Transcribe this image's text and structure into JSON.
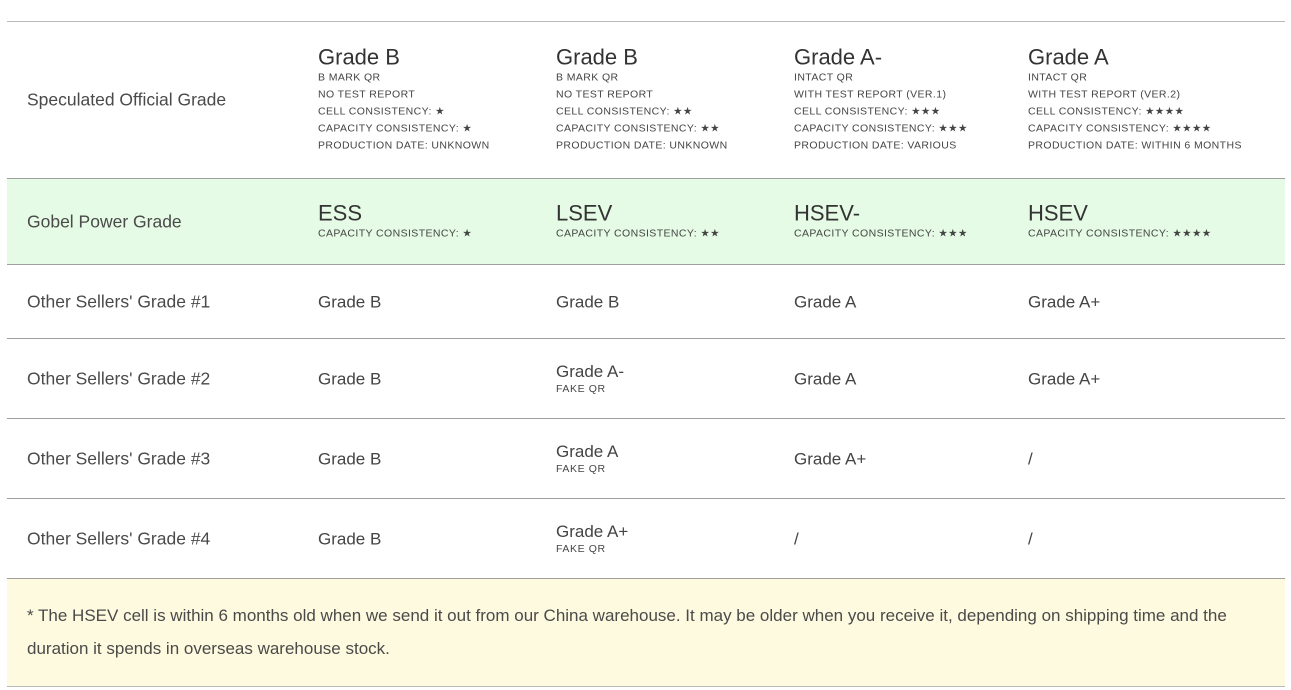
{
  "rows": {
    "official": {
      "label": "Speculated Official Grade",
      "cells": [
        {
          "title": "Grade B",
          "lines": [
            "B MARK QR",
            "NO TEST REPORT",
            "CELL CONSISTENCY: ★",
            "CAPACITY CONSISTENCY: ★",
            "PRODUCTION DATE: UNKNOWN"
          ]
        },
        {
          "title": "Grade B",
          "lines": [
            "B MARK QR",
            "NO TEST REPORT",
            "CELL CONSISTENCY: ★★",
            "CAPACITY CONSISTENCY: ★★",
            "PRODUCTION DATE: UNKNOWN"
          ]
        },
        {
          "title": "Grade A-",
          "lines": [
            "INTACT QR",
            "WITH TEST REPORT (VER.1)",
            "CELL CONSISTENCY: ★★★",
            "CAPACITY CONSISTENCY: ★★★",
            "PRODUCTION DATE: VARIOUS"
          ]
        },
        {
          "title": "Grade A",
          "lines": [
            "INTACT QR",
            "WITH TEST REPORT (VER.2)",
            "CELL CONSISTENCY: ★★★★",
            "CAPACITY CONSISTENCY: ★★★★",
            "PRODUCTION DATE: WITHIN 6 MONTHS"
          ]
        }
      ]
    },
    "gobel": {
      "label": "Gobel Power Grade",
      "cells": [
        {
          "title": "ESS",
          "line": "CAPACITY CONSISTENCY: ★"
        },
        {
          "title": "LSEV",
          "line": "CAPACITY CONSISTENCY: ★★"
        },
        {
          "title": "HSEV-",
          "line": "CAPACITY CONSISTENCY: ★★★"
        },
        {
          "title": "HSEV",
          "line": "CAPACITY CONSISTENCY: ★★★★"
        }
      ]
    },
    "other1": {
      "label": "Other Sellers' Grade #1",
      "cells": [
        {
          "value": "Grade B",
          "tag": ""
        },
        {
          "value": "Grade B",
          "tag": ""
        },
        {
          "value": "Grade A",
          "tag": ""
        },
        {
          "value": "Grade A+",
          "tag": ""
        }
      ]
    },
    "other2": {
      "label": "Other Sellers' Grade #2",
      "cells": [
        {
          "value": "Grade B",
          "tag": ""
        },
        {
          "value": "Grade A-",
          "tag": "FAKE QR"
        },
        {
          "value": "Grade A",
          "tag": ""
        },
        {
          "value": "Grade A+",
          "tag": ""
        }
      ]
    },
    "other3": {
      "label": "Other Sellers' Grade #3",
      "cells": [
        {
          "value": "Grade B",
          "tag": ""
        },
        {
          "value": "Grade A",
          "tag": "FAKE QR"
        },
        {
          "value": "Grade A+",
          "tag": ""
        },
        {
          "value": "/",
          "tag": ""
        }
      ]
    },
    "other4": {
      "label": "Other Sellers' Grade #4",
      "cells": [
        {
          "value": "Grade B",
          "tag": ""
        },
        {
          "value": "Grade A+",
          "tag": "FAKE QR"
        },
        {
          "value": "/",
          "tag": ""
        },
        {
          "value": "/",
          "tag": ""
        }
      ]
    }
  },
  "note": "* The HSEV cell is within 6 months old when we send it out from our China warehouse. It may be older when you receive it, depending on shipping time and the duration it spends in overseas warehouse stock.",
  "colors": {
    "gobel_row_bg": "#e5fbe5",
    "note_bg": "#fefadf",
    "divider": "#9f9f9f"
  }
}
